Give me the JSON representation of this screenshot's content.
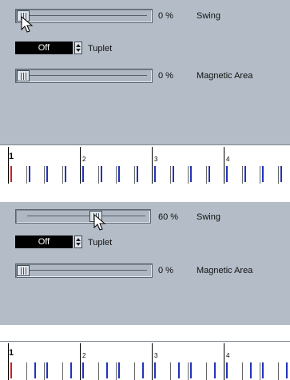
{
  "panels": [
    {
      "swing": {
        "label": "Swing",
        "percent_text": "0 %",
        "value_fraction": 0.0
      },
      "tuplet": {
        "value": "Off",
        "label": "Tuplet"
      },
      "magnetic": {
        "label": "Magnetic Area",
        "percent_text": "0 %",
        "value_fraction": 0.0
      },
      "ruler": {
        "bars": [
          "1",
          "2",
          "3",
          "4"
        ]
      }
    },
    {
      "swing": {
        "label": "Swing",
        "percent_text": "60 %",
        "value_fraction": 0.6
      },
      "tuplet": {
        "value": "Off",
        "label": "Tuplet"
      },
      "magnetic": {
        "label": "Magnetic Area",
        "percent_text": "0 %",
        "value_fraction": 0.0
      },
      "ruler": {
        "bars": [
          "1",
          "2",
          "3",
          "4"
        ]
      }
    }
  ],
  "colors": {
    "panel_bg": "#b3bcc7",
    "grid_note": "#2233bb",
    "note_red": "#cc2222"
  },
  "icons": {
    "pointer": "mouse-pointer-icon"
  }
}
